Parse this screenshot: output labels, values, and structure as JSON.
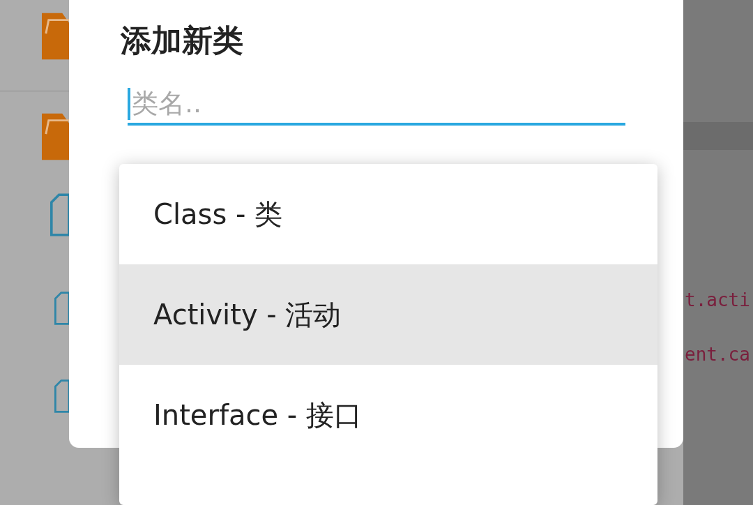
{
  "file_list": [
    {
      "kind": "folder"
    },
    {
      "kind": "divider"
    },
    {
      "kind": "folder"
    },
    {
      "kind": "file"
    },
    {
      "kind": "file"
    },
    {
      "kind": "file"
    }
  ],
  "code_lines": [
    "t.acti",
    "ent.ca"
  ],
  "dialog": {
    "title": "添加新类",
    "input": {
      "placeholder": "类名.."
    }
  },
  "dropdown": {
    "items": [
      {
        "label": "Class - 类",
        "selected": false
      },
      {
        "label": "Activity - 活动",
        "selected": true
      },
      {
        "label": "Interface - 接口",
        "selected": false
      }
    ]
  }
}
